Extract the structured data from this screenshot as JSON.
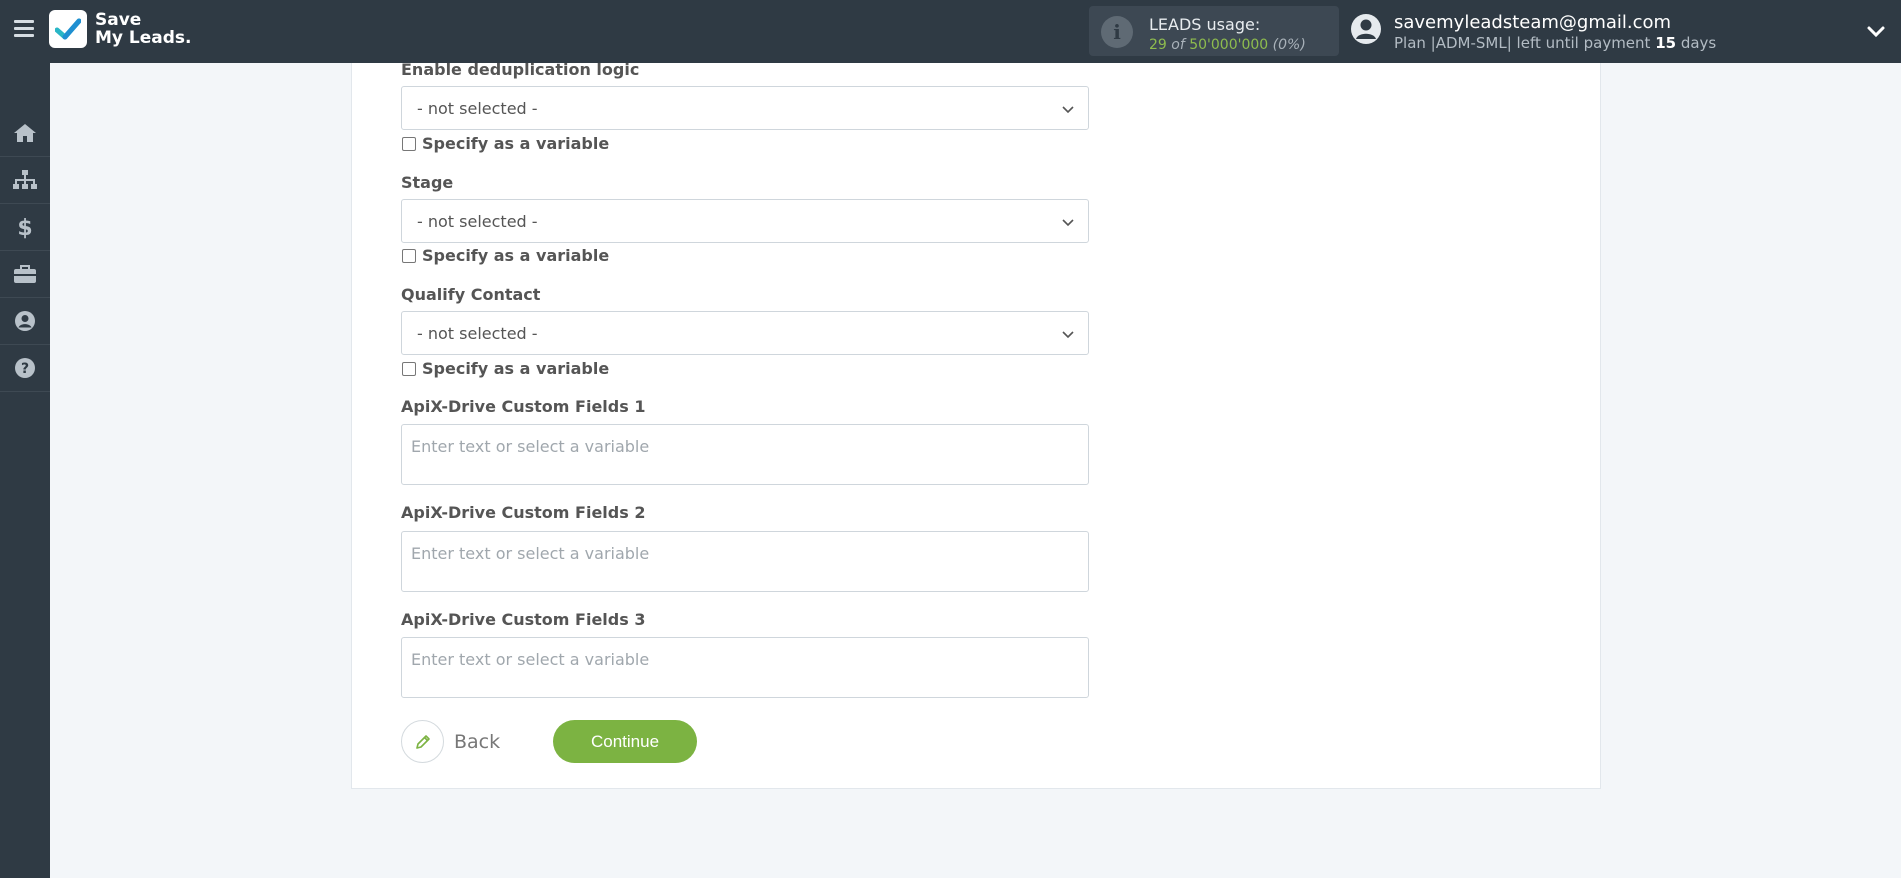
{
  "brand": {
    "line1": "Save",
    "line2": "My Leads."
  },
  "usage": {
    "title": "LEADS usage:",
    "used": "29",
    "of": "of",
    "limit": "50'000'000",
    "percent": "(0%)"
  },
  "user": {
    "email": "savemyleadsteam@gmail.com",
    "plan_prefix": "Plan |ADM-SML| left until payment ",
    "plan_days": "15",
    "plan_suffix": " days"
  },
  "sidebar": {
    "items": [
      {
        "name": "home-icon"
      },
      {
        "name": "sitemap-icon"
      },
      {
        "name": "dollar-icon"
      },
      {
        "name": "briefcase-icon"
      },
      {
        "name": "user-circle-icon"
      },
      {
        "name": "help-icon"
      }
    ]
  },
  "form": {
    "dedup": {
      "label": "Enable deduplication logic",
      "value": "- not selected -",
      "checkbox": "Specify as a variable"
    },
    "stage": {
      "label": "Stage",
      "value": "- not selected -",
      "checkbox": "Specify as a variable"
    },
    "qualify": {
      "label": "Qualify Contact",
      "value": "- not selected -",
      "checkbox": "Specify as a variable"
    },
    "custom1": {
      "label": "ApiX-Drive Custom Fields 1",
      "placeholder": "Enter text or select a variable",
      "value": ""
    },
    "custom2": {
      "label": "ApiX-Drive Custom Fields 2",
      "placeholder": "Enter text or select a variable",
      "value": ""
    },
    "custom3": {
      "label": "ApiX-Drive Custom Fields 3",
      "placeholder": "Enter text or select a variable",
      "value": ""
    }
  },
  "actions": {
    "back": "Back",
    "continue": "Continue"
  },
  "colors": {
    "topbar": "#2f3a44",
    "accent": "#7cb342",
    "panel": "#ffffff",
    "background": "#f3f6f9"
  }
}
